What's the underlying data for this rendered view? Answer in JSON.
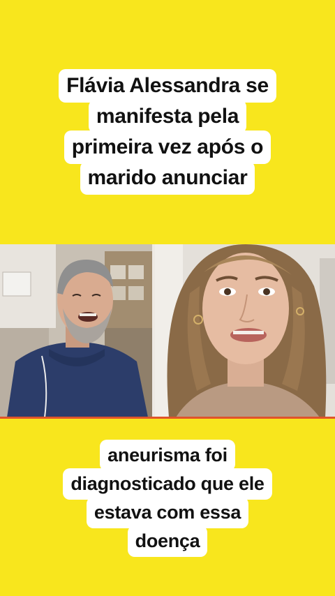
{
  "caption_top": {
    "lines": [
      "Flávia Alessandra se",
      "manifesta pela",
      "primeira vez após o",
      "marido anunciar"
    ]
  },
  "caption_bottom": {
    "lines": [
      "aneurisma foi",
      "diagnosticado que ele",
      "estava com essa",
      "doença"
    ]
  },
  "colors": {
    "background": "#f8e61d",
    "caption_bg": "#ffffff",
    "caption_text": "#111111",
    "accent_line": "#e0542a"
  }
}
